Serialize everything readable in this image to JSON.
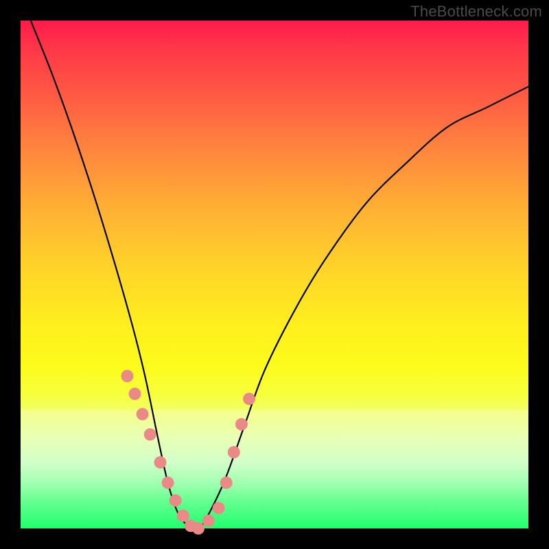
{
  "watermark": "TheBottleneck.com",
  "chart_data": {
    "type": "line",
    "title": "",
    "xlabel": "",
    "ylabel": "",
    "xlim": [
      0,
      1
    ],
    "ylim": [
      0,
      1
    ],
    "series": [
      {
        "name": "bottleneck-curve",
        "x": [
          0.02,
          0.06,
          0.1,
          0.14,
          0.18,
          0.22,
          0.245,
          0.27,
          0.29,
          0.31,
          0.33,
          0.345,
          0.36,
          0.4,
          0.44,
          0.48,
          0.54,
          0.6,
          0.68,
          0.76,
          0.84,
          0.92,
          1.0
        ],
        "y": [
          1.0,
          0.9,
          0.79,
          0.67,
          0.54,
          0.4,
          0.3,
          0.18,
          0.09,
          0.03,
          0.005,
          0.0,
          0.01,
          0.09,
          0.2,
          0.31,
          0.43,
          0.53,
          0.64,
          0.72,
          0.79,
          0.83,
          0.87
        ]
      }
    ],
    "markers": {
      "name": "highlight-dots",
      "color": "#e98a86",
      "x": [
        0.21,
        0.225,
        0.24,
        0.255,
        0.275,
        0.29,
        0.305,
        0.32,
        0.335,
        0.35,
        0.37,
        0.39,
        0.405,
        0.42,
        0.435,
        0.45
      ],
      "y": [
        0.3,
        0.265,
        0.225,
        0.185,
        0.13,
        0.09,
        0.055,
        0.025,
        0.005,
        0.0,
        0.015,
        0.04,
        0.09,
        0.15,
        0.205,
        0.255
      ]
    },
    "legend_band_top_y_fraction": 0.233
  }
}
